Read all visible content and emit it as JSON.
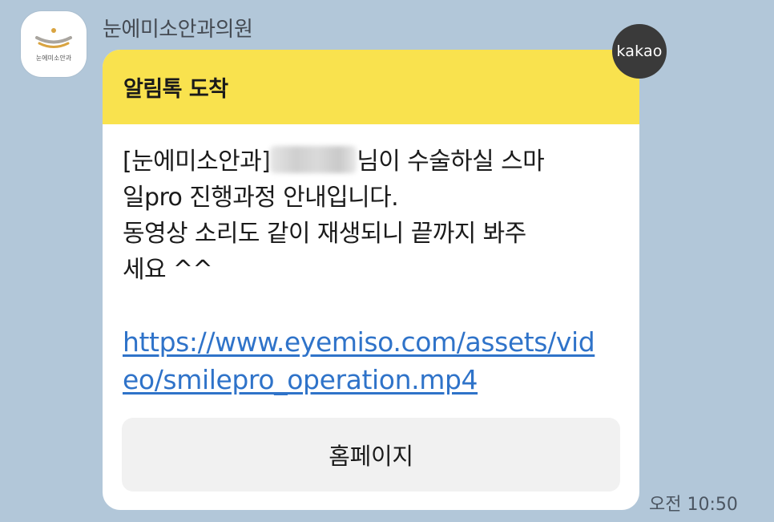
{
  "chat": {
    "sender_name": "눈에미소안과의원",
    "avatar_logo_text": "눈에미소안과",
    "kakao_badge": "kakao",
    "timestamp": "오전 10:50"
  },
  "message": {
    "header_title": "알림톡 도착",
    "line1_prefix": "[눈에미소안과]",
    "line1_suffix": "님이 수술하실 스마",
    "line2": "일pro 진행과정 안내입니다.",
    "line3": "동영상 소리도 같이 재생되니 끝까지 봐주",
    "line4": "세요 ^^",
    "link_line1": "https://www.eyemiso.com/assets/vid",
    "link_line2": "eo/smilepro_operation.mp4",
    "button_label": "홈페이지"
  },
  "colors": {
    "background": "#b2c7d9",
    "header_yellow": "#f9e24e",
    "link_blue": "#2f73c9",
    "button_gray": "#f1f1f1",
    "logo_gold": "#d9a441"
  }
}
